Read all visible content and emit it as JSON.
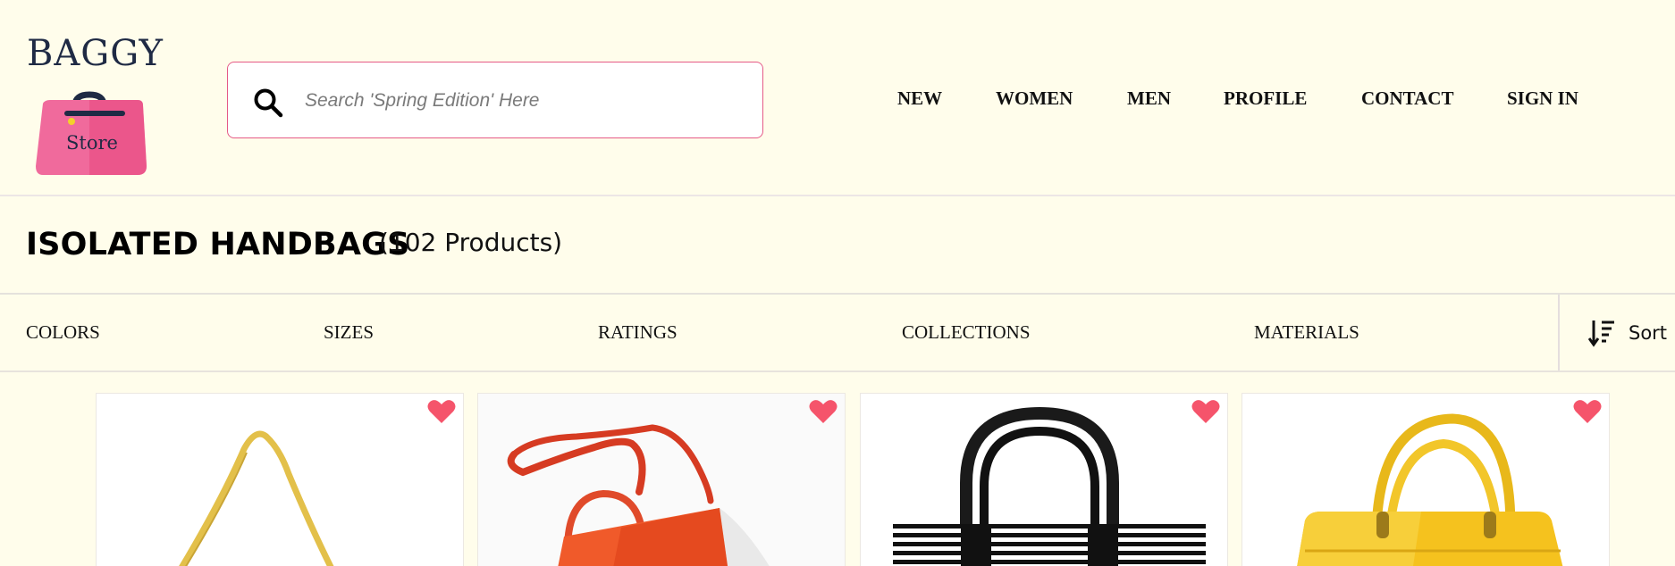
{
  "header": {
    "logo": {
      "brand": "BAGGY",
      "subtitle": "Store",
      "colors": {
        "bag": "#f06a9c",
        "bag_dark": "#e8457e",
        "text": "#1f2a44"
      }
    },
    "search": {
      "placeholder": "Search 'Spring Edition' Here",
      "value": "",
      "icon": "search-icon",
      "border_color": "#e55a86"
    },
    "nav": [
      {
        "label": "NEW"
      },
      {
        "label": "WOMEN"
      },
      {
        "label": "MEN"
      },
      {
        "label": "PROFILE"
      },
      {
        "label": "CONTACT"
      },
      {
        "label": "SIGN IN"
      }
    ]
  },
  "page": {
    "title": "ISOLATED HANDBAGS",
    "count": "(102 Products)"
  },
  "filters": [
    {
      "label": "COLORS"
    },
    {
      "label": "SIZES"
    },
    {
      "label": "RATINGS"
    },
    {
      "label": "COLLECTIONS"
    },
    {
      "label": "MATERIALS"
    }
  ],
  "sort": {
    "label": "Sort",
    "icon": "sort-descending-icon"
  },
  "products": [
    {
      "image": "yellow-shoulder-bag",
      "favorite_icon": "heart-icon"
    },
    {
      "image": "red-crossbody-bag",
      "favorite_icon": "heart-icon"
    },
    {
      "image": "black-white-striped-tote",
      "favorite_icon": "heart-icon"
    },
    {
      "image": "yellow-top-handle-bag",
      "favorite_icon": "heart-icon"
    }
  ],
  "colors": {
    "background": "#fffdeb",
    "accent": "#e55a86",
    "heart": "#f5546b"
  }
}
